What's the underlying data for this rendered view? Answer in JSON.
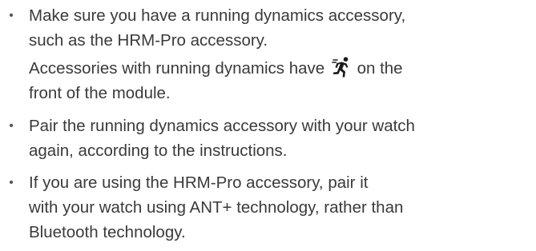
{
  "bullet_char": "•",
  "items": [
    {
      "lines": [
        "Make sure you have a running dynamics accessory,",
        "such as the HRM-Pro accessory."
      ],
      "note": {
        "before_icon": "Accessories with running dynamics have",
        "icon": "running-dynamics-runner-icon",
        "after_icon": "on the",
        "line2": "front of the module."
      }
    },
    {
      "lines": [
        "Pair the running dynamics accessory with your watch",
        "again, according to the instructions."
      ]
    },
    {
      "lines": [
        "If you are using the HRM-Pro accessory, pair it",
        "with your watch using ANT+ technology, rather than",
        "Bluetooth technology."
      ]
    }
  ]
}
